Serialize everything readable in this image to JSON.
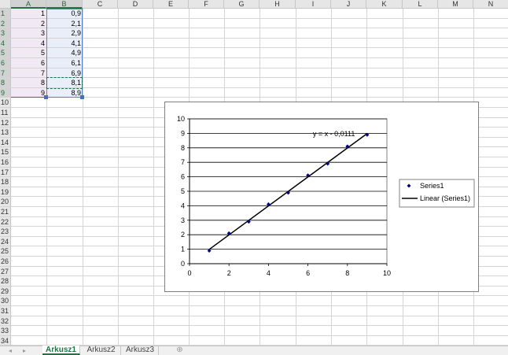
{
  "columns": [
    "A",
    "B",
    "C",
    "D",
    "E",
    "F",
    "G",
    "H",
    "I",
    "J",
    "K",
    "L",
    "M",
    "N"
  ],
  "rows": [
    "1",
    "2",
    "3",
    "4",
    "5",
    "6",
    "7",
    "8",
    "9",
    "10",
    "11",
    "12",
    "13",
    "14",
    "15",
    "16",
    "17",
    "18",
    "19",
    "20",
    "21",
    "22",
    "23",
    "24",
    "25",
    "26",
    "27",
    "28",
    "29",
    "30",
    "31",
    "32",
    "33",
    "34"
  ],
  "cells": {
    "A": [
      "1",
      "2",
      "3",
      "4",
      "5",
      "6",
      "7",
      "8",
      "9"
    ],
    "B": [
      "0,9",
      "2,1",
      "2,9",
      "4,1",
      "4,9",
      "6,1",
      "6,9",
      "8,1",
      "8,9"
    ]
  },
  "sheet_tabs": [
    "Arkusz1",
    "Arkusz2",
    "Arkusz3"
  ],
  "active_tab": "Arkusz1",
  "add_sheet_icon": "plus-circle-icon",
  "chart": {
    "trendline_label": "y = x - 0,0111",
    "legend": [
      "Series1",
      "Linear (Series1)"
    ],
    "series_color": "#000080",
    "trend_color": "#000000"
  },
  "chart_data": {
    "type": "scatter",
    "series": [
      {
        "name": "Series1",
        "x": [
          1,
          2,
          3,
          4,
          5,
          6,
          7,
          8,
          9
        ],
        "y": [
          0.9,
          2.1,
          2.9,
          4.1,
          4.9,
          6.1,
          6.9,
          8.1,
          8.9
        ]
      },
      {
        "name": "Linear (Series1)",
        "x": [
          1,
          9
        ],
        "y": [
          0.9889,
          8.9889
        ]
      }
    ],
    "xlim": [
      0,
      10
    ],
    "ylim": [
      0,
      10
    ],
    "xticks": [
      "0",
      "2",
      "4",
      "6",
      "8",
      "10"
    ],
    "yticks": [
      "0",
      "1",
      "2",
      "3",
      "4",
      "5",
      "6",
      "7",
      "8",
      "9",
      "10"
    ],
    "annotations": [
      "y = x - 0,0111"
    ],
    "legend_position": "right",
    "grid": "horizontal major"
  }
}
